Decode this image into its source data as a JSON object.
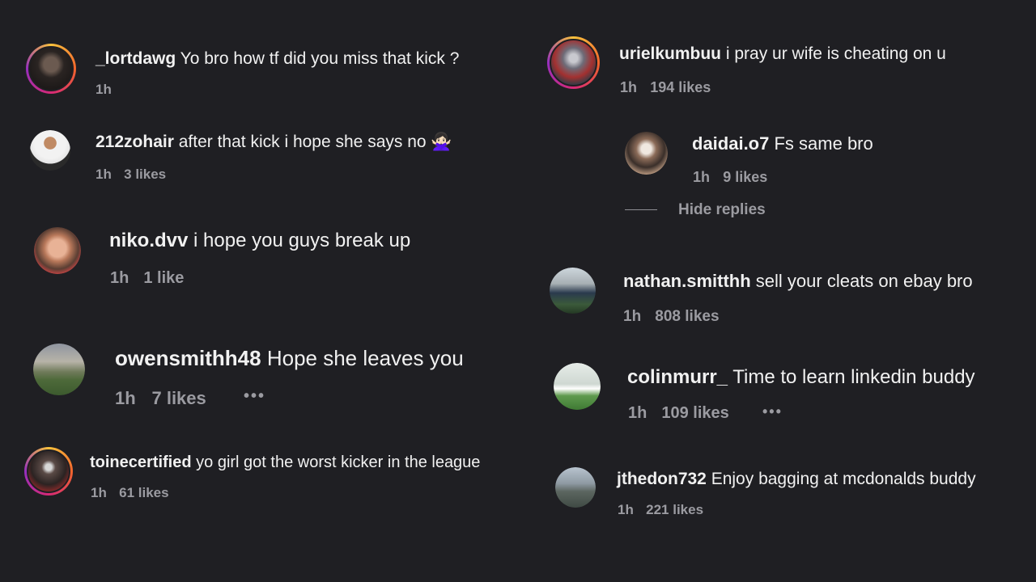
{
  "comments": [
    {
      "username": "_lortdawg",
      "text": "Yo bro how tf did you miss that kick ?",
      "time": "1h",
      "likes": "",
      "avatar_icon": "profile-photo-icon"
    },
    {
      "username": "212zohair",
      "text": "after that kick i hope she says no 🙅🏻‍♀️",
      "time": "1h",
      "likes": "3 likes",
      "avatar_icon": "profile-photo-icon"
    },
    {
      "username": "niko.dvv",
      "text": "i hope you guys break up",
      "time": "1h",
      "likes": "1 like",
      "avatar_icon": "profile-photo-icon"
    },
    {
      "username": "owensmithh48",
      "text": "Hope she leaves you",
      "time": "1h",
      "likes": "7 likes",
      "more": "•••",
      "avatar_icon": "profile-photo-icon"
    },
    {
      "username": "toinecertified",
      "text": "yo girl got the worst kicker in the league",
      "time": "1h",
      "likes": "61 likes",
      "avatar_icon": "profile-photo-icon"
    },
    {
      "username": "urielkumbuu",
      "text": "i pray ur wife is cheating on u",
      "time": "1h",
      "likes": "194 likes",
      "avatar_icon": "profile-photo-icon"
    },
    {
      "username": "daidai.o7",
      "text": "Fs same bro",
      "time": "1h",
      "likes": "9 likes",
      "avatar_icon": "profile-photo-icon"
    },
    {
      "username": "nathan.smitthh",
      "text": "sell your cleats on ebay bro",
      "time": "1h",
      "likes": "808 likes",
      "avatar_icon": "profile-photo-icon"
    },
    {
      "username": "colinmurr_",
      "text": "Time to learn linkedin buddy",
      "time": "1h",
      "likes": "109 likes",
      "more": "•••",
      "avatar_icon": "profile-photo-icon"
    },
    {
      "username": "jthedon732",
      "text": "Enjoy bagging at mcdonalds buddy",
      "time": "1h",
      "likes": "221 likes",
      "avatar_icon": "profile-photo-icon"
    }
  ],
  "hide_replies_label": "Hide replies",
  "colors": {
    "background": "#1f1f23",
    "text": "#f1f1f1",
    "meta": "#9b9ba1"
  }
}
